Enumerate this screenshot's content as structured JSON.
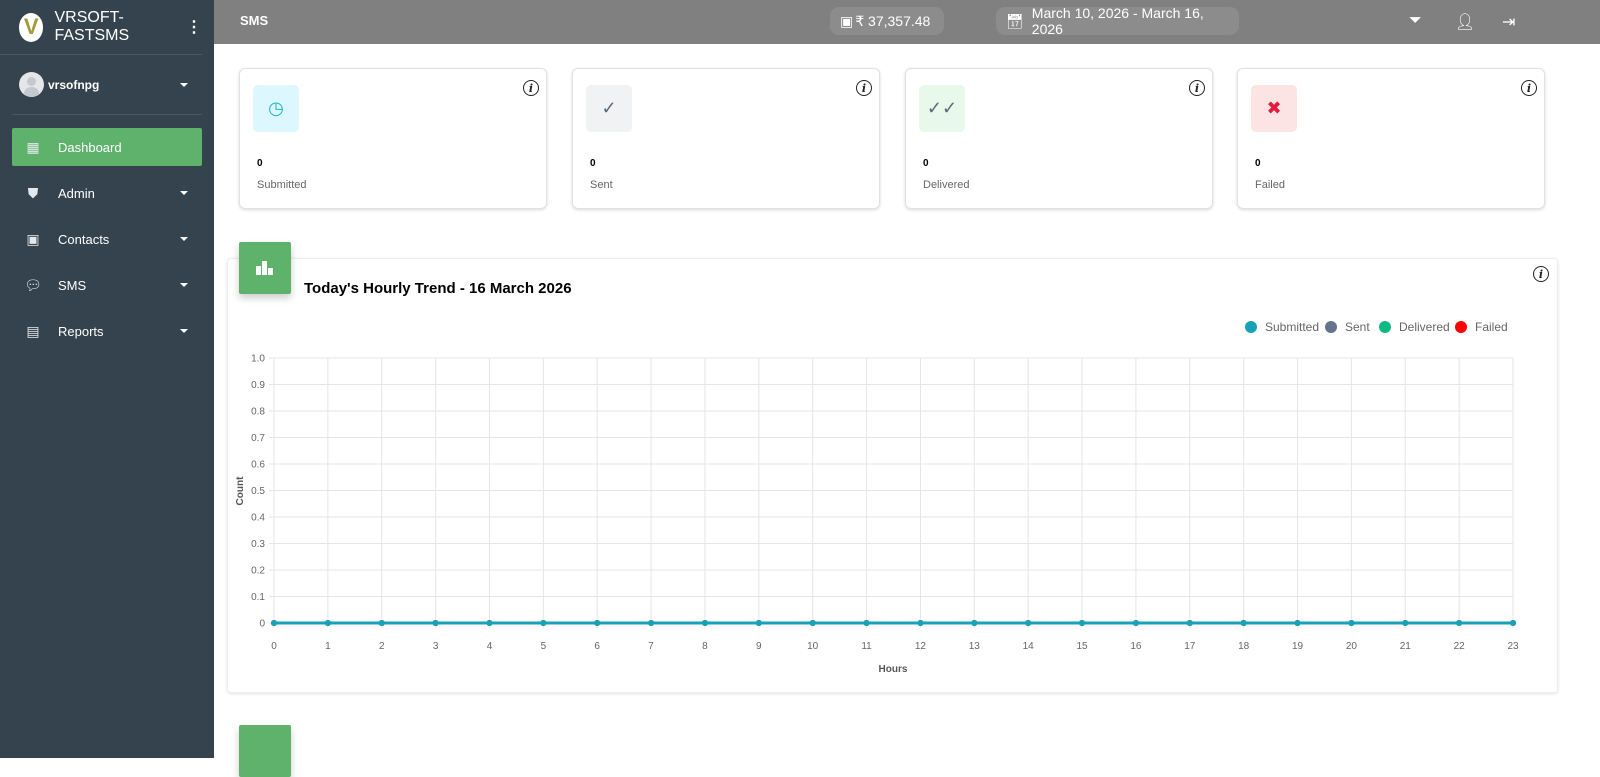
{
  "brand": {
    "name": "VRSOFT-FASTSMS",
    "logo_letter": "V"
  },
  "user": {
    "name": "vrsofnpg"
  },
  "sidebar": {
    "items": [
      {
        "label": "Dashboard",
        "icon": "dashboard-icon"
      },
      {
        "label": "Admin",
        "icon": "shield-user-icon"
      },
      {
        "label": "Contacts",
        "icon": "contact-card-icon"
      },
      {
        "label": "SMS",
        "icon": "message-icon"
      },
      {
        "label": "Reports",
        "icon": "report-file-icon"
      }
    ]
  },
  "topbar": {
    "title": "SMS",
    "balance": "₹ 37,357.48",
    "date_range": "March 10, 2026 - March 16, 2026"
  },
  "cards": [
    {
      "value": "0",
      "label": "Submitted",
      "bg": "#dcf7fd",
      "fg": "#20b4c8"
    },
    {
      "value": "0",
      "label": "Sent",
      "bg": "#f1f2f4",
      "fg": "#5c6b7a"
    },
    {
      "value": "0",
      "label": "Delivered",
      "bg": "#e8f8ea",
      "fg": "#5c6b7a"
    },
    {
      "value": "0",
      "label": "Failed",
      "bg": "#fde4e4",
      "fg": "#e6193c"
    }
  ],
  "chart_data": {
    "type": "line",
    "title": "Today's Hourly Trend - 16 March 2026",
    "xlabel": "Hours",
    "ylabel": "Count",
    "ylim": [
      0,
      1
    ],
    "x": [
      0,
      1,
      2,
      3,
      4,
      5,
      6,
      7,
      8,
      9,
      10,
      11,
      12,
      13,
      14,
      15,
      16,
      17,
      18,
      19,
      20,
      21,
      22,
      23
    ],
    "yticks": [
      "0",
      "0.1",
      "0.2",
      "0.3",
      "0.4",
      "0.5",
      "0.6",
      "0.7",
      "0.8",
      "0.9",
      "1.0"
    ],
    "legend_position": "top-right",
    "series": [
      {
        "name": "Submitted",
        "color": "#17a2b8",
        "values": [
          0,
          0,
          0,
          0,
          0,
          0,
          0,
          0,
          0,
          0,
          0,
          0,
          0,
          0,
          0,
          0,
          0,
          0,
          0,
          0,
          0,
          0,
          0,
          0
        ]
      },
      {
        "name": "Sent",
        "color": "#64748b",
        "values": [
          0,
          0,
          0,
          0,
          0,
          0,
          0,
          0,
          0,
          0,
          0,
          0,
          0,
          0,
          0,
          0,
          0,
          0,
          0,
          0,
          0,
          0,
          0,
          0
        ]
      },
      {
        "name": "Delivered",
        "color": "#10b981",
        "values": [
          0,
          0,
          0,
          0,
          0,
          0,
          0,
          0,
          0,
          0,
          0,
          0,
          0,
          0,
          0,
          0,
          0,
          0,
          0,
          0,
          0,
          0,
          0,
          0
        ]
      },
      {
        "name": "Failed",
        "color": "#ff0000",
        "values": [
          0,
          0,
          0,
          0,
          0,
          0,
          0,
          0,
          0,
          0,
          0,
          0,
          0,
          0,
          0,
          0,
          0,
          0,
          0,
          0,
          0,
          0,
          0,
          0
        ]
      }
    ]
  }
}
